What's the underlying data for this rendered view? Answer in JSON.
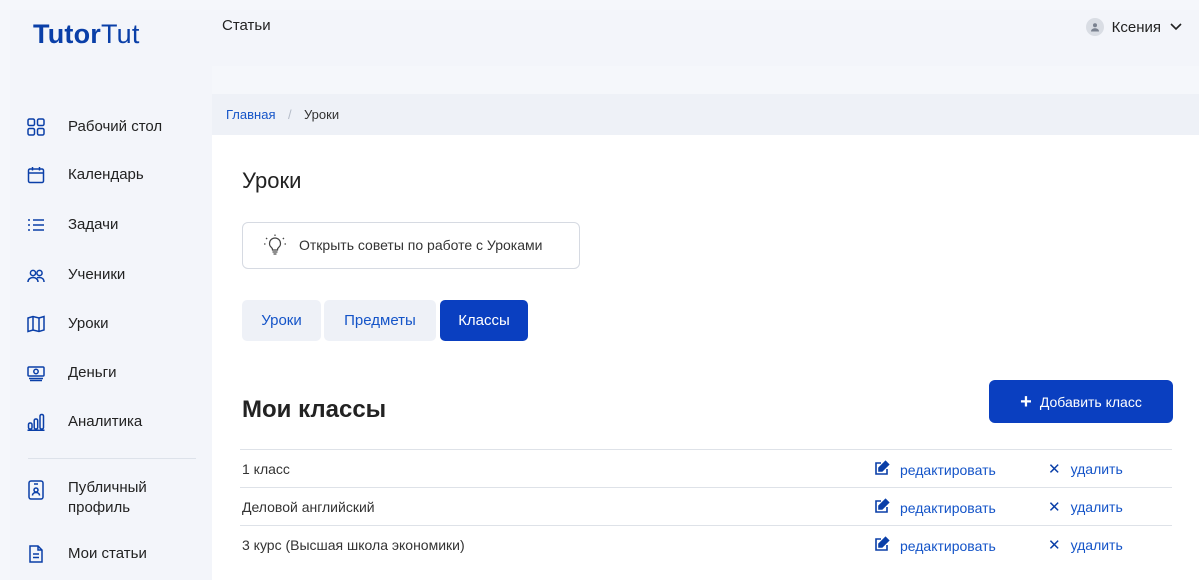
{
  "logo": {
    "bold": "Tutor",
    "regular": "Tut"
  },
  "topbar": {
    "articles": "Статьи",
    "user_name": "Ксения"
  },
  "sidebar": {
    "items": [
      {
        "label": "Рабочий стол",
        "icon": "dashboard-icon"
      },
      {
        "label": "Календарь",
        "icon": "calendar-icon"
      },
      {
        "label": "Задачи",
        "icon": "list-icon"
      },
      {
        "label": "Ученики",
        "icon": "users-icon"
      },
      {
        "label": "Уроки",
        "icon": "book-icon"
      },
      {
        "label": "Деньги",
        "icon": "money-icon"
      },
      {
        "label": "Аналитика",
        "icon": "analytics-icon"
      },
      {
        "label": "Публичный профиль",
        "icon": "profile-card-icon"
      },
      {
        "label": "Мои статьи",
        "icon": "document-icon"
      }
    ]
  },
  "breadcrumb": {
    "home": "Главная",
    "separator": "/",
    "current": "Уроки"
  },
  "page": {
    "title": "Уроки",
    "tips_button": "Открыть советы по работе с Уроками",
    "tabs": [
      {
        "label": "Уроки",
        "active": false
      },
      {
        "label": "Предметы",
        "active": false
      },
      {
        "label": "Классы",
        "active": true
      }
    ],
    "section_title": "Мои классы",
    "add_button": "Добавить класс",
    "rows": [
      {
        "name": "1 класс",
        "edit": "редактировать",
        "delete": "удалить"
      },
      {
        "name": "Деловой английский",
        "edit": "редактировать",
        "delete": "удалить"
      },
      {
        "name": "3 курс (Высшая школа экономики)",
        "edit": "редактировать",
        "delete": "удалить"
      }
    ]
  },
  "colors": {
    "brand": "#0a3fa8",
    "accent_button": "#0a3fc0",
    "link": "#1454c8"
  }
}
